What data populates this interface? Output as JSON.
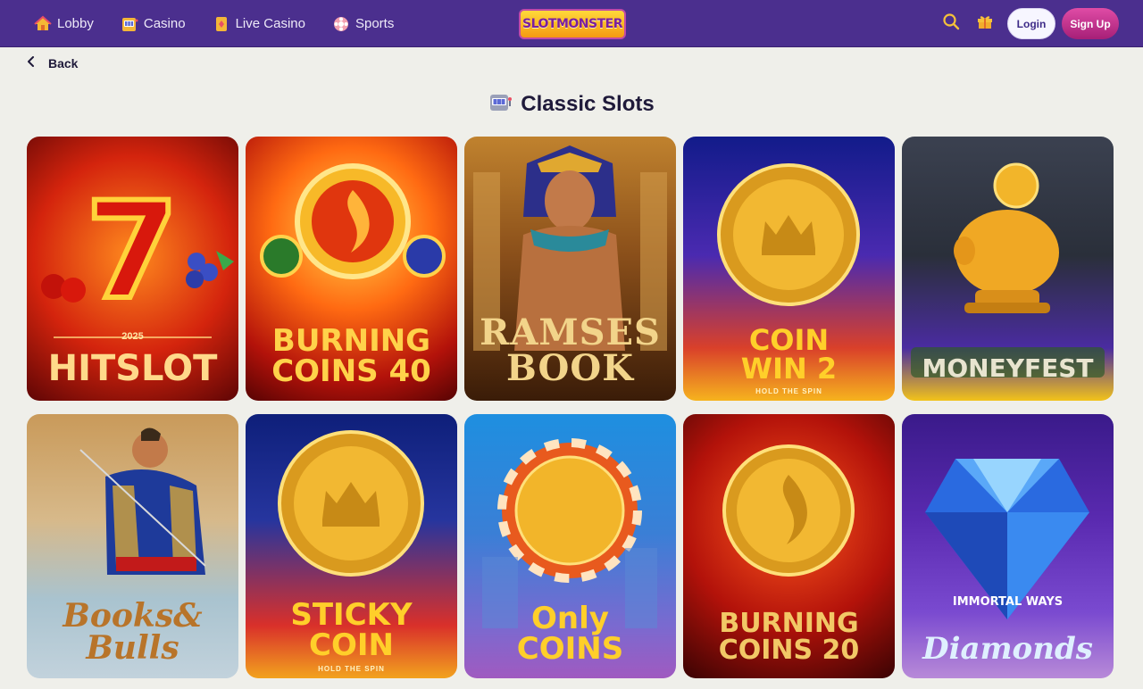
{
  "nav": {
    "items": [
      {
        "label": "Lobby",
        "icon": "home-icon"
      },
      {
        "label": "Casino",
        "icon": "slot-machine-icon"
      },
      {
        "label": "Live Casino",
        "icon": "playing-card-icon"
      },
      {
        "label": "Sports",
        "icon": "sports-ball-icon"
      }
    ]
  },
  "brand": {
    "logo_text": "SLOTMONSTER"
  },
  "header": {
    "login_label": "Login",
    "signup_label": "Sign Up",
    "search_icon": "search-icon",
    "gift_icon": "gift-icon"
  },
  "back": {
    "label": "Back",
    "icon": "chevron-left-icon"
  },
  "page": {
    "title": "Classic Slots",
    "title_icon": "slot-machine-icon"
  },
  "colors": {
    "header_bg": "#4b2f8e",
    "page_bg": "#efefea",
    "signup_bg": "#c23088",
    "text_dark": "#1f1a3a"
  },
  "games": [
    {
      "name": "HITSLOT",
      "top": "2025"
    },
    {
      "name": "BURNING\nCOINS 40"
    },
    {
      "name": "RAMSES\nBOOK"
    },
    {
      "name": "COIN\nWIN 2",
      "sub": "HOLD THE SPIN"
    },
    {
      "name": "MONEYFEST"
    },
    {
      "name": "Books&\nBulls"
    },
    {
      "name": "STICKY\nCOIN",
      "sub": "HOLD THE SPIN"
    },
    {
      "name": "Only\nCOINS"
    },
    {
      "name": "BURNING\nCOINS 20"
    },
    {
      "name": "Diamonds",
      "top": "IMMORTAL WAYS"
    }
  ]
}
